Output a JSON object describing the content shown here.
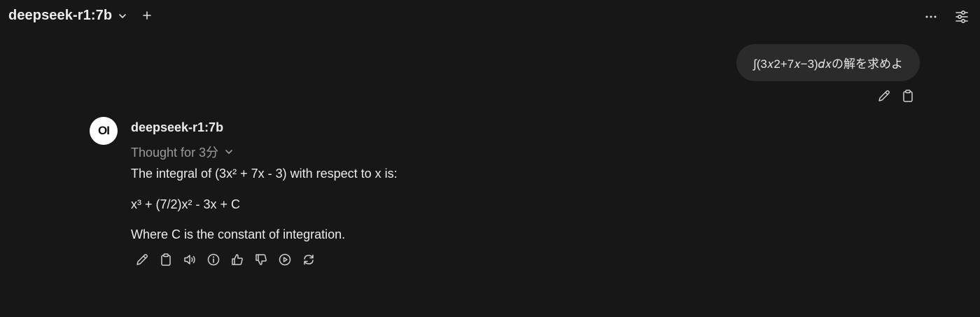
{
  "header": {
    "model_name": "deepseek-r1:7b",
    "icons": {
      "model_dropdown": "chevron-down-icon",
      "new_chat": "plus-icon",
      "more": "ellipsis-icon",
      "controls": "sliders-icon"
    }
  },
  "user_message": {
    "text": "∫(3𝑥2+7𝑥−3)𝑑𝑥の解を求めよ",
    "actions": [
      "edit-icon",
      "copy-icon"
    ]
  },
  "assistant_message": {
    "avatar_text": "OI",
    "model_name": "deepseek-r1:7b",
    "thought_label": "Thought for 3分",
    "paragraphs": [
      "The integral of (3x² + 7x - 3) with respect to x is:",
      "x³ + (7/2)x² - 3x + C",
      "Where C is the constant of integration."
    ],
    "actions": [
      "edit-icon",
      "copy-icon",
      "speaker-icon",
      "info-icon",
      "thumbs-up-icon",
      "thumbs-down-icon",
      "play-circle-icon",
      "regenerate-icon"
    ]
  },
  "colors": {
    "background": "#171717",
    "bubble": "#2b2b2b",
    "text": "#ececec",
    "muted": "#9b9b9b",
    "icon": "#cfcfcf"
  }
}
